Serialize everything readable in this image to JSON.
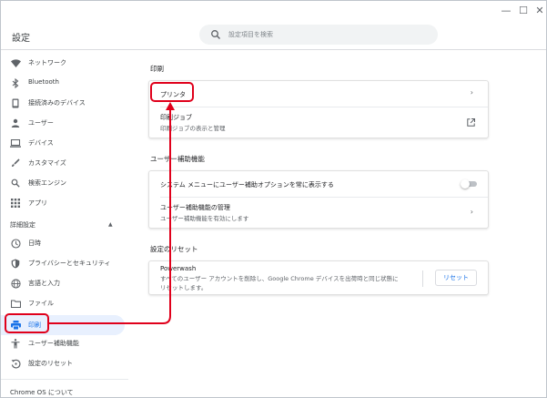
{
  "window": {
    "controls": [
      "—",
      "☐",
      "✕"
    ]
  },
  "header": {
    "title": "設定",
    "search_placeholder": "設定項目を検索"
  },
  "sidebar": {
    "items": [
      {
        "label": "ネットワーク",
        "icon": "wifi-icon"
      },
      {
        "label": "Bluetooth",
        "icon": "bluetooth-icon"
      },
      {
        "label": "接続済みのデバイス",
        "icon": "phone-icon"
      },
      {
        "label": "ユーザー",
        "icon": "person-icon"
      },
      {
        "label": "デバイス",
        "icon": "laptop-icon"
      },
      {
        "label": "カスタマイズ",
        "icon": "brush-icon"
      },
      {
        "label": "検索エンジン",
        "icon": "search-icon"
      },
      {
        "label": "アプリ",
        "icon": "apps-icon"
      }
    ],
    "advanced_label": "詳細設定",
    "advanced_items": [
      {
        "label": "日時",
        "icon": "clock-icon"
      },
      {
        "label": "プライバシーとセキュリティ",
        "icon": "shield-icon"
      },
      {
        "label": "言語と入力",
        "icon": "globe-icon"
      },
      {
        "label": "ファイル",
        "icon": "folder-icon"
      },
      {
        "label": "印刷",
        "icon": "printer-icon",
        "active": true
      },
      {
        "label": "ユーザー補助機能",
        "icon": "accessibility-icon"
      },
      {
        "label": "設定のリセット",
        "icon": "restore-icon"
      }
    ],
    "about_label": "Chrome OS について"
  },
  "main": {
    "print": {
      "title": "印刷",
      "printer_label": "プリンタ",
      "jobs_label": "印刷ジョブ",
      "jobs_sub": "印刷ジョブの表示と管理"
    },
    "accessibility": {
      "title": "ユーザー補助機能",
      "show_options_label": "システム メニューにユーザー補助オプションを常に表示する",
      "show_options_enabled": false,
      "manage_label": "ユーザー補助機能の管理",
      "manage_sub": "ユーザー補助機能を有効にします"
    },
    "reset": {
      "title": "設定のリセット",
      "powerwash_label": "Powerwash",
      "powerwash_sub_line1": "すべてのユーザー アカウントを削除し、Google Chrome デバイスを出荷時と同じ状態に",
      "powerwash_sub_line2": "リセットします。",
      "reset_button": "リセット"
    }
  },
  "colors": {
    "accent": "#1a73e8",
    "highlight": "#e0001b",
    "active_bg": "#e8f0fe"
  }
}
